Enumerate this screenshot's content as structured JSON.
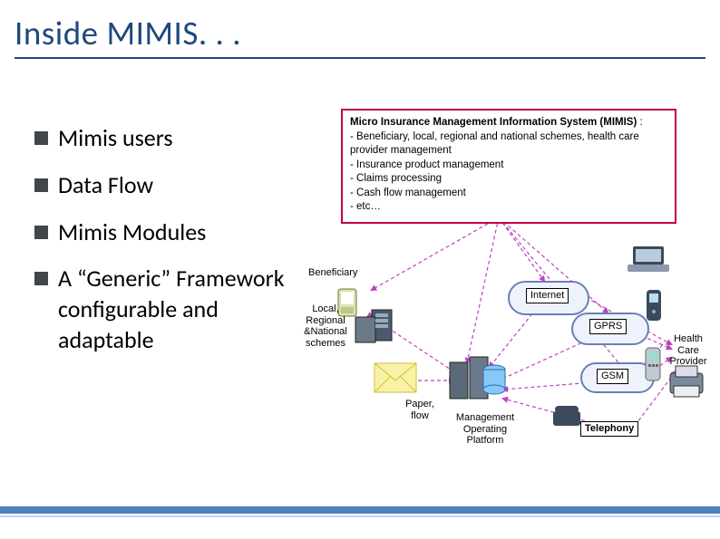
{
  "title": "Inside MIMIS. . .",
  "bullets": [
    {
      "text": "Mimis users"
    },
    {
      "text": "Data Flow"
    },
    {
      "text": "Mimis Modules"
    },
    {
      "text": "A “Generic” Framework configurable and adaptable"
    }
  ],
  "diagram": {
    "box_title": "Micro Insurance Management Information System (MIMIS)",
    "box_suffix": "  :",
    "box_lines": [
      "- Beneficiary, local, regional and national schemes, health care provider management",
      "- Insurance product management",
      "- Claims processing",
      "- Cash flow management",
      "- etc…"
    ],
    "labels": {
      "beneficiary": "Beneficiary",
      "schemes": "Local, Regional &National schemes",
      "paper": "Paper, flow",
      "platform": "Management Operating Platform",
      "provider": "Health Care Provider",
      "internet": "Internet",
      "gprs": "GPRS",
      "gsm": "GSM",
      "telephony": "Telephony"
    }
  }
}
